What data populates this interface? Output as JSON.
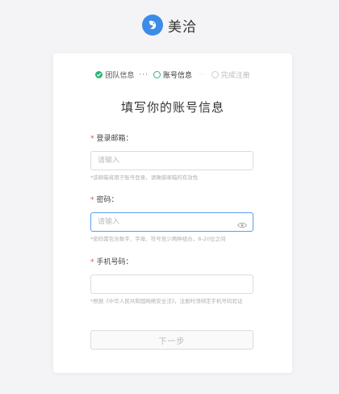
{
  "brand": {
    "name": "美洽",
    "logo_icon": "bird-logo-icon",
    "logo_color": "#3d8be8"
  },
  "steps": [
    {
      "label": "团队信息",
      "state": "done"
    },
    {
      "label": "账号信息",
      "state": "active"
    },
    {
      "label": "完成注册",
      "state": "todo"
    }
  ],
  "separator": "···",
  "form": {
    "title": "填写你的账号信息",
    "required_mark": "*",
    "email": {
      "label": "登录邮箱：",
      "placeholder": "请输入",
      "hint": "*该邮箱将用于账号登录，请确保邮箱的有效性"
    },
    "password": {
      "label": "密码：",
      "placeholder": "请输入",
      "hint": "*密码需包含数字、字母、符号至少两种组合，8-20位之间"
    },
    "phone": {
      "label": "手机号码：",
      "placeholder": "",
      "hint": "*根据《中华人民共和国网络安全法》，注册时须绑定手机号码验证"
    },
    "next_label": "下一步"
  },
  "colors": {
    "accent_green": "#2bb673",
    "focus_blue": "#5b9cf3",
    "required_red": "#e54d42"
  }
}
